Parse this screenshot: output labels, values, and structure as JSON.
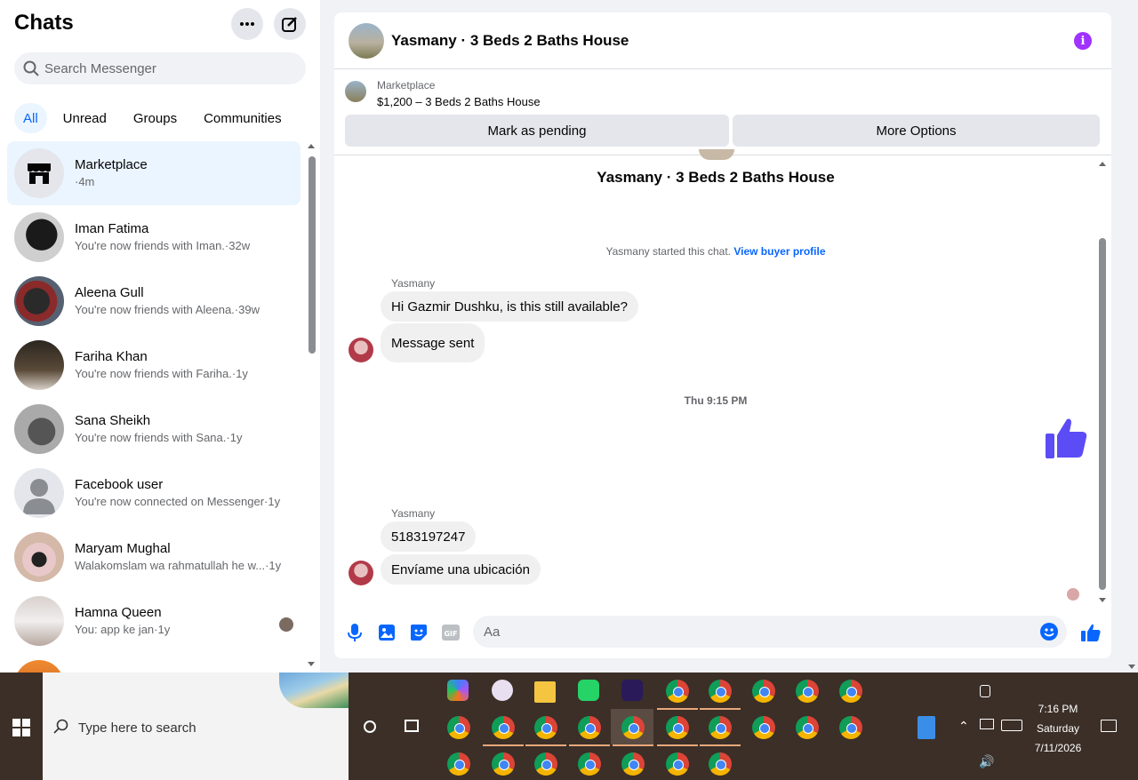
{
  "sidebar": {
    "title": "Chats",
    "search_placeholder": "Search Messenger",
    "filters": [
      "All",
      "Unread",
      "Groups",
      "Communities"
    ],
    "chats": [
      {
        "name": "Marketplace",
        "preview": "·4m"
      },
      {
        "name": "Iman Fatima",
        "preview": "You're now friends with Iman.·32w"
      },
      {
        "name": "Aleena Gull",
        "preview": "You're now friends with Aleena.·39w"
      },
      {
        "name": "Fariha Khan",
        "preview": "You're now friends with Fariha.·1y"
      },
      {
        "name": "Sana Sheikh",
        "preview": "You're now friends with Sana.·1y"
      },
      {
        "name": "Facebook user",
        "preview": "You're now connected on Messenger·1y"
      },
      {
        "name": "Maryam Mughal",
        "preview": "Walakomslam wa rahmatullah he w...·1y"
      },
      {
        "name": "Hamna Queen",
        "preview": "You: app ke jan·1y"
      }
    ]
  },
  "conversation": {
    "title": "Yasmany · 3 Beds 2 Baths House",
    "marketplace_label": "Marketplace",
    "listing": "$1,200 – 3 Beds 2 Baths House",
    "mark_pending": "Mark as pending",
    "more_options": "More Options",
    "thread_title": "Yasmany · 3 Beds 2 Baths House",
    "system_text": "Yasmany started this chat.",
    "view_buyer": "View buyer profile",
    "sender": "Yasmany",
    "msg1": "Hi Gazmir Dushku, is this still available?",
    "msg2": "Message sent",
    "timestamp": "Thu 9:15 PM",
    "msg3": "5183197247",
    "msg4": "Envíame una ubicación",
    "input_placeholder": "Aa"
  },
  "taskbar": {
    "search_placeholder": "Type here to search",
    "time": "7:16 PM",
    "day": "Saturday",
    "date": "7/11/2026"
  },
  "colors": {
    "accent": "#0866ff",
    "selected_bg": "#ebf5ff",
    "like": "#5b4cf5",
    "info": "#a033ff"
  }
}
